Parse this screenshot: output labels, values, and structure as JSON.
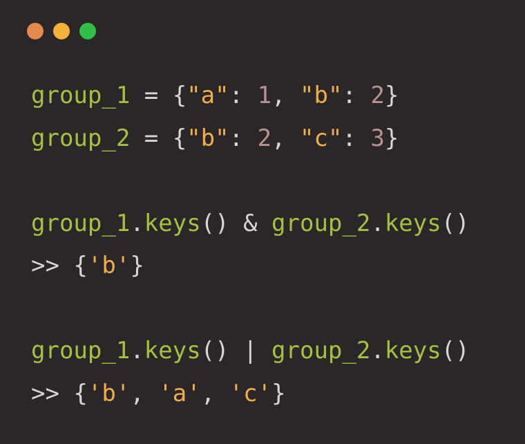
{
  "window": {
    "controls": [
      {
        "name": "close",
        "color": "#e5894f"
      },
      {
        "name": "minimize",
        "color": "#f3b33a"
      },
      {
        "name": "zoom",
        "color": "#2fc046"
      }
    ]
  },
  "colors": {
    "background": "#2b2628",
    "identifier": "#a4c23f",
    "operator": "#d8d5d2",
    "string": "#f0ae48",
    "number": "#b8938f"
  },
  "code": {
    "lines": [
      [
        {
          "t": "group_1",
          "k": "id"
        },
        {
          "t": " = {",
          "k": "op"
        },
        {
          "t": "\"a\"",
          "k": "str"
        },
        {
          "t": ": ",
          "k": "op"
        },
        {
          "t": "1",
          "k": "num"
        },
        {
          "t": ", ",
          "k": "op"
        },
        {
          "t": "\"b\"",
          "k": "str"
        },
        {
          "t": ": ",
          "k": "op"
        },
        {
          "t": "2",
          "k": "num"
        },
        {
          "t": "}",
          "k": "op"
        }
      ],
      [
        {
          "t": "group_2",
          "k": "id"
        },
        {
          "t": " = {",
          "k": "op"
        },
        {
          "t": "\"b\"",
          "k": "str"
        },
        {
          "t": ": ",
          "k": "op"
        },
        {
          "t": "2",
          "k": "num"
        },
        {
          "t": ", ",
          "k": "op"
        },
        {
          "t": "\"c\"",
          "k": "str"
        },
        {
          "t": ": ",
          "k": "op"
        },
        {
          "t": "3",
          "k": "num"
        },
        {
          "t": "}",
          "k": "op"
        }
      ],
      [],
      [
        {
          "t": "group_1",
          "k": "id"
        },
        {
          "t": ".",
          "k": "op"
        },
        {
          "t": "keys",
          "k": "id"
        },
        {
          "t": "() & ",
          "k": "op"
        },
        {
          "t": "group_2",
          "k": "id"
        },
        {
          "t": ".",
          "k": "op"
        },
        {
          "t": "keys",
          "k": "id"
        },
        {
          "t": "()",
          "k": "op"
        }
      ],
      [
        {
          "t": ">> {",
          "k": "out"
        },
        {
          "t": "'b'",
          "k": "str"
        },
        {
          "t": "}",
          "k": "out"
        }
      ],
      [],
      [
        {
          "t": "group_1",
          "k": "id"
        },
        {
          "t": ".",
          "k": "op"
        },
        {
          "t": "keys",
          "k": "id"
        },
        {
          "t": "() | ",
          "k": "op"
        },
        {
          "t": "group_2",
          "k": "id"
        },
        {
          "t": ".",
          "k": "op"
        },
        {
          "t": "keys",
          "k": "id"
        },
        {
          "t": "()",
          "k": "op"
        }
      ],
      [
        {
          "t": ">> {",
          "k": "out"
        },
        {
          "t": "'b'",
          "k": "str"
        },
        {
          "t": ", ",
          "k": "out"
        },
        {
          "t": "'a'",
          "k": "str"
        },
        {
          "t": ", ",
          "k": "out"
        },
        {
          "t": "'c'",
          "k": "str"
        },
        {
          "t": "}",
          "k": "out"
        }
      ]
    ]
  }
}
